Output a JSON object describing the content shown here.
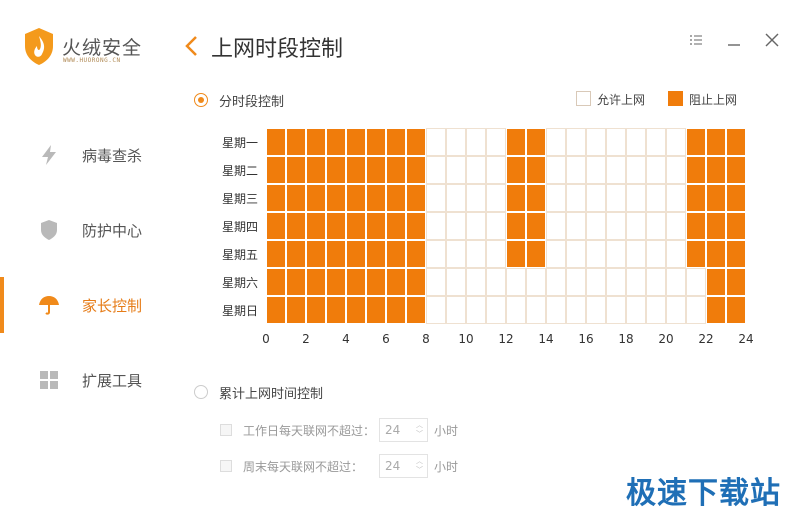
{
  "app": {
    "brand": "火绒安全",
    "brand_sub": "WWW.HUORONG.CN"
  },
  "sidebar": {
    "items": [
      {
        "label": "病毒查杀",
        "icon": "lightning-icon",
        "active": false
      },
      {
        "label": "防护中心",
        "icon": "shield-icon",
        "active": false
      },
      {
        "label": "家长控制",
        "icon": "umbrella-icon",
        "active": true
      },
      {
        "label": "扩展工具",
        "icon": "grid-icon",
        "active": false
      }
    ]
  },
  "header": {
    "title": "上网时段控制",
    "back_icon": "chevron-left-icon",
    "controls": [
      "menu-icon",
      "minimize-icon",
      "close-icon"
    ]
  },
  "schedule": {
    "mode_label": "分时段控制",
    "mode_selected": true,
    "legend": {
      "allow": "允许上网",
      "block": "阻止上网",
      "allow_color": "#ffffff",
      "block_color": "#f07c0b"
    },
    "days": [
      "星期一",
      "星期二",
      "星期三",
      "星期四",
      "星期五",
      "星期六",
      "星期日"
    ],
    "hour_ticks": [
      "0",
      "2",
      "4",
      "6",
      "8",
      "10",
      "12",
      "14",
      "16",
      "18",
      "20",
      "22",
      "24"
    ],
    "blocked_hours": [
      [
        0,
        1,
        2,
        3,
        4,
        5,
        6,
        7,
        12,
        13,
        21,
        22,
        23
      ],
      [
        0,
        1,
        2,
        3,
        4,
        5,
        6,
        7,
        12,
        13,
        21,
        22,
        23
      ],
      [
        0,
        1,
        2,
        3,
        4,
        5,
        6,
        7,
        12,
        13,
        21,
        22,
        23
      ],
      [
        0,
        1,
        2,
        3,
        4,
        5,
        6,
        7,
        12,
        13,
        21,
        22,
        23
      ],
      [
        0,
        1,
        2,
        3,
        4,
        5,
        6,
        7,
        12,
        13,
        21,
        22,
        23
      ],
      [
        0,
        1,
        2,
        3,
        4,
        5,
        6,
        7,
        22,
        23
      ],
      [
        0,
        1,
        2,
        3,
        4,
        5,
        6,
        7,
        22,
        23
      ]
    ]
  },
  "cumulative": {
    "mode_label": "累计上网时间控制",
    "mode_selected": false,
    "weekday": {
      "label": "工作日每天联网不超过：",
      "value": "24",
      "unit": "小时"
    },
    "weekend": {
      "label": "周末每天联网不超过：",
      "value": "24",
      "unit": "小时"
    }
  },
  "watermark": "极速下载站"
}
